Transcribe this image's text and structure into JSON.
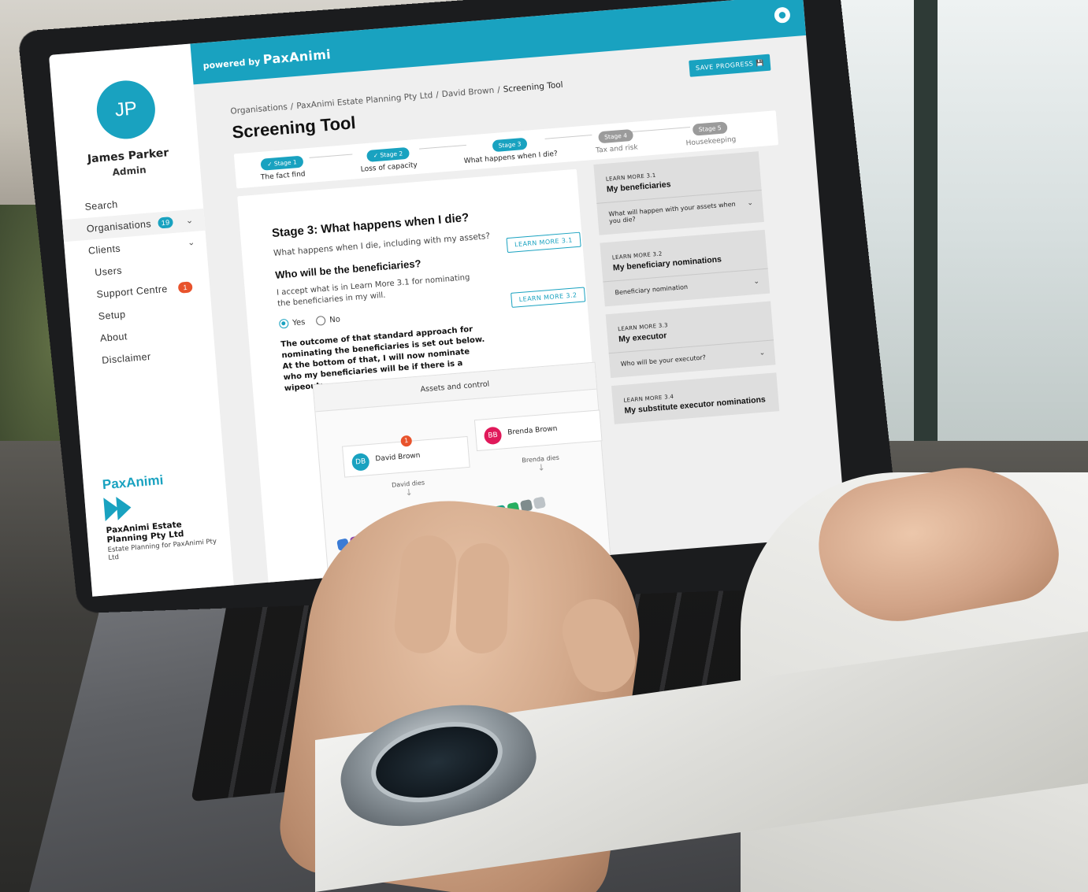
{
  "topbar": {
    "powered_prefix": "powered by",
    "powered_brand": "PaxAnimi"
  },
  "sidebar": {
    "avatar_initials": "JP",
    "user_name": "James Parker",
    "user_role": "Admin",
    "items": [
      {
        "label": "Search"
      },
      {
        "label": "Organisations",
        "badge": "19"
      },
      {
        "label": "Clients"
      },
      {
        "label": "Users"
      },
      {
        "label": "Support Centre",
        "badge": "1"
      },
      {
        "label": "Setup"
      },
      {
        "label": "About"
      },
      {
        "label": "Disclaimer"
      }
    ],
    "brand": {
      "logo_text": "PaxAnimi",
      "org_name": "PaxAnimi Estate Planning Pty Ltd",
      "org_sub": "Estate Planning for PaxAnimi Pty Ltd"
    }
  },
  "breadcrumb": {
    "items": [
      "Organisations",
      "PaxAnimi Estate Planning Pty Ltd",
      "David Brown"
    ],
    "current": "Screening Tool",
    "separator": "/"
  },
  "page": {
    "title": "Screening Tool",
    "save_label": "SAVE PROGRESS"
  },
  "stepper": {
    "steps": [
      {
        "pill": "✓ Stage 1",
        "label": "The fact find",
        "state": "done"
      },
      {
        "pill": "✓ Stage 2",
        "label": "Loss of capacity",
        "state": "done"
      },
      {
        "pill": "Stage 3",
        "label": "What happens when I die?",
        "state": "current"
      },
      {
        "pill": "Stage 4",
        "label": "Tax and risk",
        "state": "todo"
      },
      {
        "pill": "Stage 5",
        "label": "Housekeeping",
        "state": "todo"
      }
    ]
  },
  "content": {
    "heading": "Stage 3: What happens when I die?",
    "sub": "What happens when I die, including with my assets?",
    "learn_more_1": "LEARN MORE 3.1",
    "question": "Who will be the beneficiaries?",
    "question_text": "I accept what is in Learn More 3.1 for nominating the beneficiaries in my will.",
    "learn_more_2": "LEARN MORE 3.2",
    "radio_yes": "Yes",
    "radio_no": "No",
    "outcome": "The outcome of that standard approach for nominating the beneficiaries is set out below. At the bottom of that, I will now nominate who my beneficiaries will be if there is a wipeout:"
  },
  "diagram": {
    "title": "Assets and control",
    "people": [
      {
        "initials": "DB",
        "name": "David Brown",
        "color": "#19a2c0",
        "warn": "1"
      },
      {
        "initials": "BB",
        "name": "Brenda Brown",
        "color": "#e0195a"
      }
    ],
    "events": [
      "David dies",
      "Brenda dies"
    ]
  },
  "learn_more_cards": [
    {
      "kicker": "LEARN MORE 3.1",
      "title": "My beneficiaries",
      "body": "What will happen with your assets when you die?"
    },
    {
      "kicker": "LEARN MORE 3.2",
      "title": "My beneficiary nominations",
      "body": "Beneficiary nomination"
    },
    {
      "kicker": "LEARN MORE 3.3",
      "title": "My executor",
      "body": "Who will be your executor?"
    },
    {
      "kicker": "LEARN MORE 3.4",
      "title": "My substitute executor nominations",
      "body": ""
    }
  ],
  "colors": {
    "accent": "#19a2c0",
    "alert": "#e8532c",
    "pink": "#e0195a"
  },
  "icons": {
    "user": "user-icon",
    "save": "save-icon",
    "chevron": "chevron-down-icon",
    "check": "check-icon"
  }
}
